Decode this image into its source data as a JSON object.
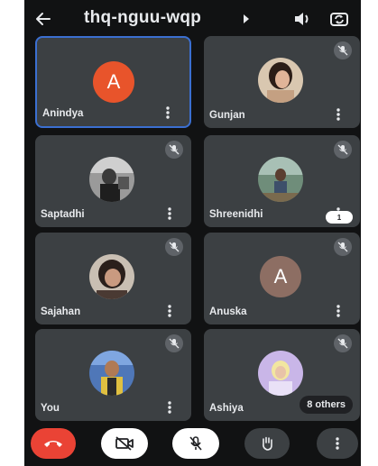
{
  "header": {
    "meeting_code": "thq-nguu-wqp",
    "icons": [
      "back-arrow-icon",
      "caret-right-icon",
      "speaker-icon",
      "switch-camera-icon"
    ]
  },
  "participants": [
    {
      "name": "Anindya",
      "avatar": "letter",
      "letter": "A",
      "avatar_color": "#e8542b",
      "muted": false,
      "active_speaker": true
    },
    {
      "name": "Gunjan",
      "avatar": "photo",
      "muted": true
    },
    {
      "name": "Saptadhi",
      "avatar": "photo",
      "muted": true
    },
    {
      "name": "Shreenidhi",
      "avatar": "photo",
      "muted": true
    },
    {
      "name": "Sajahan",
      "avatar": "photo",
      "muted": true
    },
    {
      "name": "Anuska",
      "avatar": "letter",
      "letter": "A",
      "avatar_color": "#8d6e63",
      "muted": true
    },
    {
      "name": "You",
      "avatar": "photo",
      "muted": true
    },
    {
      "name": "Ashiya",
      "avatar": "photo",
      "muted": true
    }
  ],
  "others_chip": "8 others",
  "floating_chip": "1",
  "controls": {
    "items": [
      "end-call",
      "camera-off",
      "mic-off",
      "raise-hand",
      "more-options"
    ],
    "colors": {
      "end": "#ea4335",
      "toggle_off": "#ffffff",
      "neutral": "#3c4043"
    }
  },
  "colors": {
    "background": "#111213",
    "tile": "#3c4043",
    "active_border": "#3b6fd1"
  }
}
